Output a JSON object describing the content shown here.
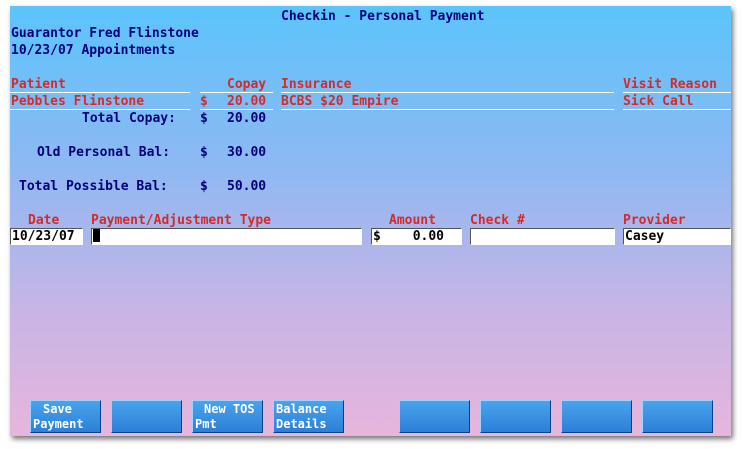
{
  "title": "Checkin - Personal Payment",
  "guarantor": "Guarantor Fred Flinstone",
  "appointments": "10/23/07 Appointments",
  "visit_header": {
    "patient": "Patient",
    "copay": "Copay",
    "insurance": "Insurance",
    "visit_reason": "Visit Reason"
  },
  "visit_row": {
    "patient": "Pebbles Flinstone",
    "currency": "$",
    "copay": "20.00",
    "insurance": "BCBS $20 Empire",
    "visit_reason": "Sick Call"
  },
  "totals": {
    "total_copay_label": "Total Copay:",
    "total_copay_currency": "$",
    "total_copay": "20.00",
    "old_bal_label": "Old Personal Bal:",
    "old_bal_currency": "$",
    "old_bal": "30.00",
    "possible_bal_label": "Total Possible Bal:",
    "possible_bal_currency": "$",
    "possible_bal": "50.00"
  },
  "payment_header": {
    "date": "Date",
    "type": "Payment/Adjustment Type",
    "amount": "Amount",
    "check": "Check #",
    "provider": "Provider"
  },
  "payment_row": {
    "date": "10/23/07",
    "type": "",
    "currency": "$",
    "amount": "0.00",
    "check": "",
    "provider": "Casey"
  },
  "fkeys": [
    {
      "line1": "Save",
      "line2": "Payment"
    },
    {
      "line1": "",
      "line2": ""
    },
    {
      "line1": "New TOS",
      "line2": "Pmt"
    },
    {
      "line1": "Balance",
      "line2": "Details"
    },
    {
      "line1": "",
      "line2": ""
    },
    {
      "line1": "",
      "line2": ""
    },
    {
      "line1": "",
      "line2": ""
    },
    {
      "line1": "",
      "line2": ""
    }
  ]
}
